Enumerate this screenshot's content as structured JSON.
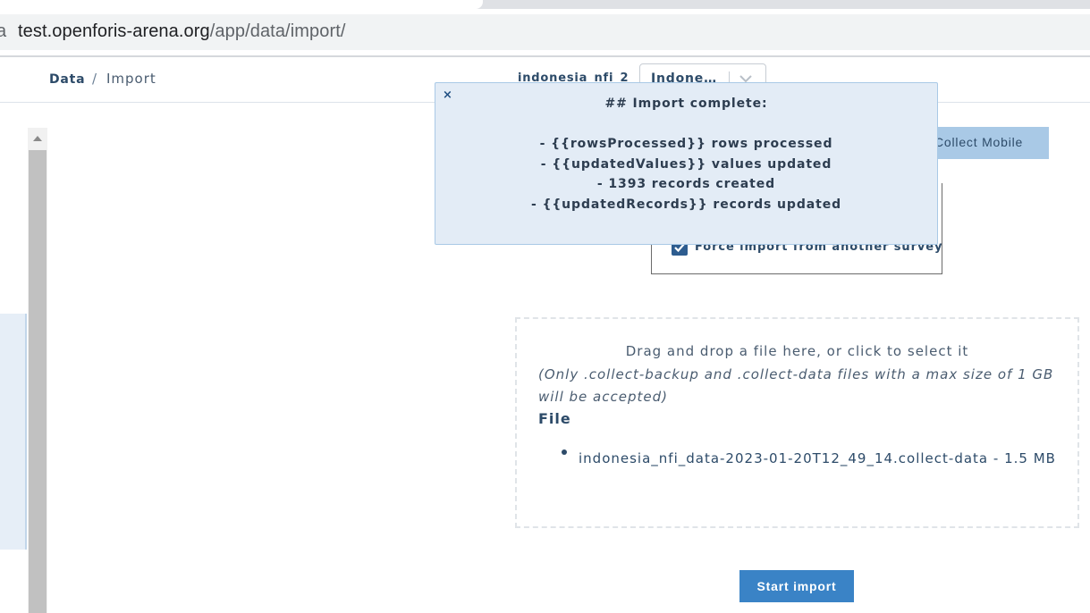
{
  "browser": {
    "url_host": "test.openforis-arena.org",
    "url_path": "/app/data/import/",
    "url_icon": "site-info-icon"
  },
  "header": {
    "breadcrumb": {
      "section": "Data",
      "separator": "/",
      "page": "Import"
    },
    "survey_name": "indonesia_nfi_2",
    "survey_select_value": "Indone…",
    "chevron_icon": "chevron-down-icon"
  },
  "toolbar": {
    "collect_mobile_label": "Collect Mobile"
  },
  "options": {
    "force_import_label": "Force import from another survey",
    "force_import_checked": true
  },
  "dropzone": {
    "title": "Drag and drop a file here, or click to select it",
    "hint": "(Only .collect-backup and .collect-data files with a max size of 1 GB will be accepted)",
    "file_heading": "File",
    "files": [
      "indonesia_nfi_data-2023-01-20T12_49_14.collect-data - 1.5 MB"
    ]
  },
  "actions": {
    "start_import_label": "Start import"
  },
  "notification": {
    "close_label": "×",
    "heading": "## Import complete:",
    "lines": [
      "- {{rowsProcessed}} rows processed",
      "- {{updatedValues}} values updated",
      "- 1393 records created",
      "- {{updatedRecords}} records updated"
    ]
  },
  "colors": {
    "primary": "#3a83c6",
    "text": "#2d4b69",
    "notification_bg": "#e3ecf6"
  }
}
